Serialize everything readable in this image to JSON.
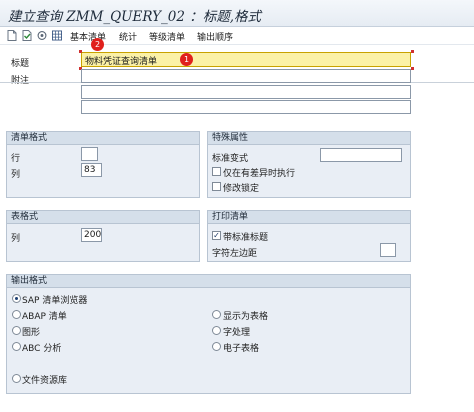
{
  "window": {
    "title": "建立查询 ZMM_QUERY_02 ：标题,格式"
  },
  "toolbar": {
    "icons": [
      "new-document-icon",
      "document-check-icon",
      "settings-icon",
      "grid-icon"
    ],
    "basic_list": "基本清单",
    "statistics": "统计",
    "ranked_list": "等级清单",
    "output_sequence": "输出顺序"
  },
  "header": {
    "title_label": "标题",
    "title_value": "物料凭证查询清单",
    "notes_label": "附注",
    "notes_lines": [
      "",
      "",
      ""
    ]
  },
  "list_format": {
    "heading": "清单格式",
    "rows_label": "行",
    "rows_value": "",
    "columns_label": "列",
    "columns_value": "83"
  },
  "special_attributes": {
    "heading": "特殊属性",
    "standard_variant_label": "标准变式",
    "standard_variant_value": "",
    "only_on_differences_label": "仅在有差异时执行",
    "only_on_differences_checked": false,
    "change_lock_label": "修改锁定",
    "change_lock_checked": false
  },
  "table_format": {
    "heading": "表格式",
    "columns_label": "列",
    "columns_value": "200"
  },
  "print_list": {
    "heading": "打印清单",
    "with_standard_title_label": "带标准标题",
    "with_standard_title_checked": true,
    "left_margin_label": "字符左边距",
    "left_margin_value": ""
  },
  "output_format": {
    "heading": "输出格式",
    "selected": "SAP 清单浏览器",
    "options": {
      "sap_list_viewer": "SAP 清单浏览器",
      "abap_list": "ABAP 清单",
      "graphics": "图形",
      "abc_analysis": "ABC 分析",
      "file_store": "文件资源库",
      "display_as_table": "显示为表格",
      "word_processing": "字处理",
      "spreadsheet": "电子表格"
    }
  },
  "annotations": {
    "marker_1": "1",
    "marker_2": "2"
  },
  "colors": {
    "highlight_field": "#fbf1a7",
    "group_background": "#e9eef5",
    "group_header": "#d5dfea",
    "marker": "#e0201c"
  }
}
